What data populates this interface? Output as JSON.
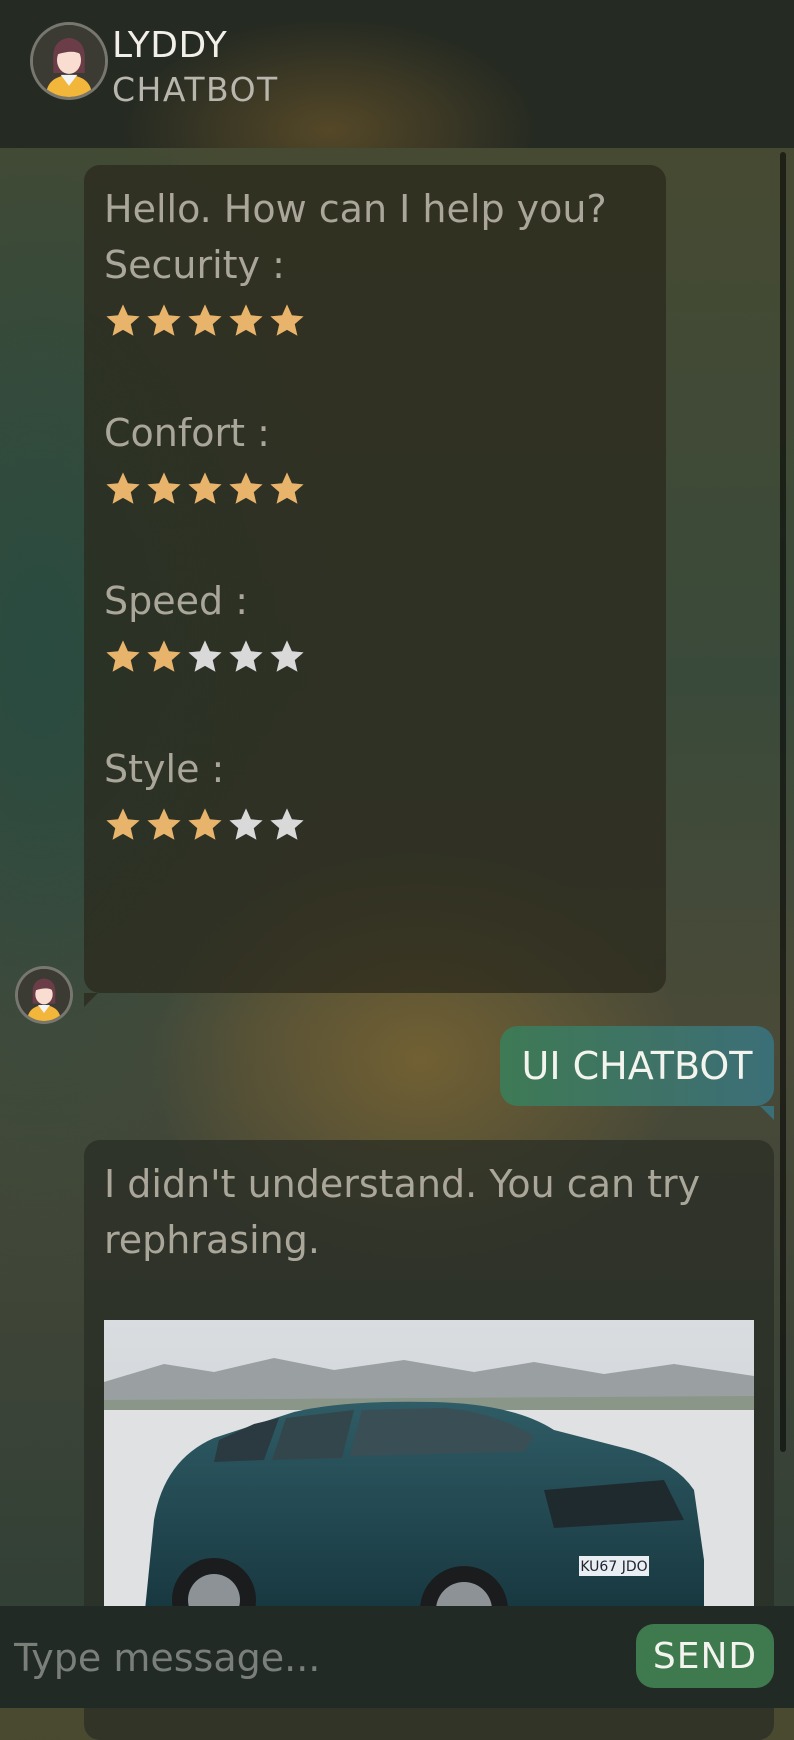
{
  "header": {
    "name": "LYDDY",
    "subtitle": "CHATBOT"
  },
  "messages": {
    "bot_greeting": "Hello. How can I help you?",
    "ratings": [
      {
        "label": "Security :",
        "value": 5,
        "max": 5
      },
      {
        "label": "Confort :",
        "value": 5,
        "max": 5
      },
      {
        "label": "Speed :",
        "value": 2,
        "max": 5
      },
      {
        "label": "Style :",
        "value": 3,
        "max": 5
      }
    ],
    "user_message": "UI CHATBOT",
    "bot_reply": "I didn't understand. You can try rephrasing.",
    "car_plate": "KU67 JDO"
  },
  "composer": {
    "placeholder": "Type message...",
    "send_label": "SEND"
  },
  "colors": {
    "star_filled": "#e8b36a",
    "star_empty": "#d9d9d9",
    "user_bubble": "#3e7a55",
    "send_button": "#3f7a4f"
  }
}
